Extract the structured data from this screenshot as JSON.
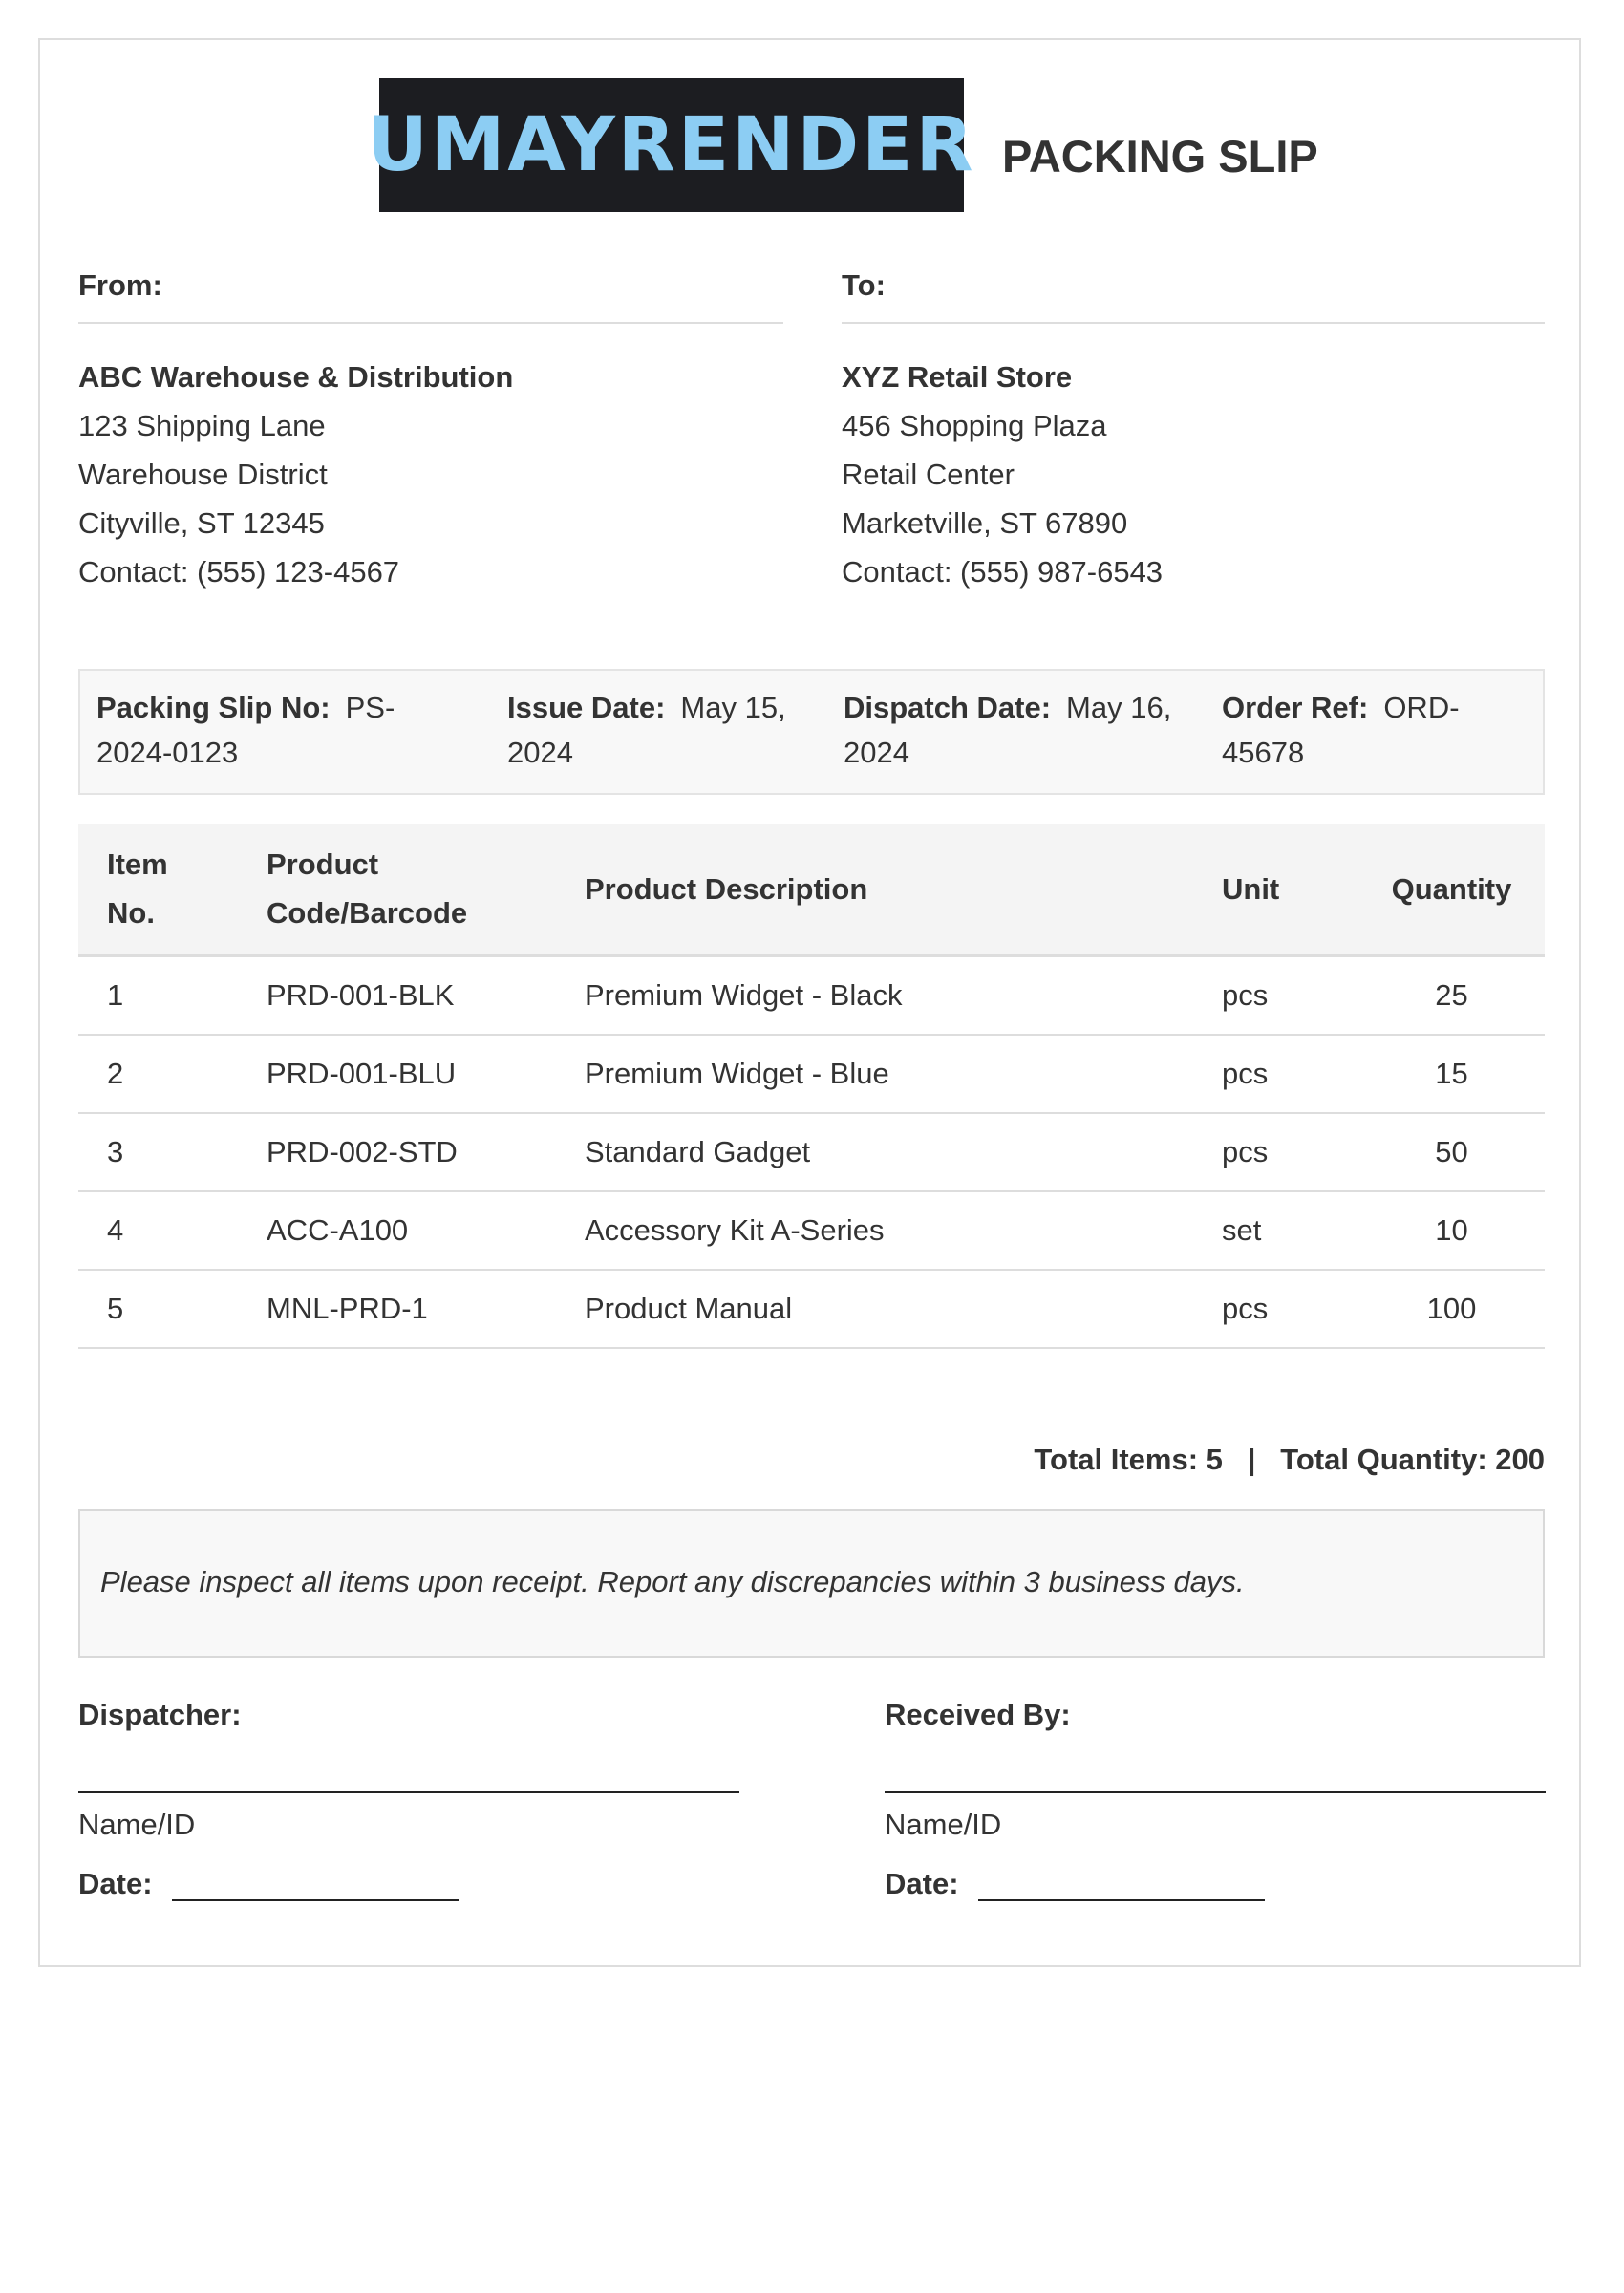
{
  "header": {
    "logo_text": "UMAYRENDER",
    "title": "PACKING SLIP"
  },
  "from": {
    "label": "From:",
    "name": "ABC Warehouse & Distribution",
    "lines": [
      "123 Shipping Lane",
      "Warehouse District",
      "Cityville, ST 12345",
      "Contact: (555) 123-4567"
    ]
  },
  "to": {
    "label": "To:",
    "name": "XYZ Retail Store",
    "lines": [
      "456 Shopping Plaza",
      "Retail Center",
      "Marketville, ST 67890",
      "Contact: (555) 987-6543"
    ]
  },
  "info": {
    "slip_no_label": "Packing Slip No:",
    "slip_no_l1": "PS-",
    "slip_no_l2": "2024-0123",
    "issue_label": "Issue Date:",
    "issue_l1": "May 15,",
    "issue_l2": "2024",
    "dispatch_label": "Dispatch Date:",
    "dispatch_l1": "May 16,",
    "dispatch_l2": "2024",
    "order_label": "Order Ref:",
    "order_l1": "ORD-",
    "order_l2": "45678"
  },
  "table": {
    "headers": {
      "item_l1": "Item",
      "item_l2": "No.",
      "code_l1": "Product",
      "code_l2": "Code/Barcode",
      "desc": "Product Description",
      "unit": "Unit",
      "qty": "Quantity"
    },
    "rows": [
      {
        "no": "1",
        "code": "PRD-001-BLK",
        "desc": "Premium Widget - Black",
        "unit": "pcs",
        "qty": "25"
      },
      {
        "no": "2",
        "code": "PRD-001-BLU",
        "desc": "Premium Widget - Blue",
        "unit": "pcs",
        "qty": "15"
      },
      {
        "no": "3",
        "code": "PRD-002-STD",
        "desc": "Standard Gadget",
        "unit": "pcs",
        "qty": "50"
      },
      {
        "no": "4",
        "code": "ACC-A100",
        "desc": "Accessory Kit A-Series",
        "unit": "set",
        "qty": "10"
      },
      {
        "no": "5",
        "code": "MNL-PRD-1",
        "desc": "Product Manual",
        "unit": "pcs",
        "qty": "100"
      }
    ]
  },
  "totals": "Total Items: 5   |   Total Quantity: 200",
  "note": "Please inspect all items upon receipt. Report any discrepancies within 3 business days.",
  "signatures": {
    "dispatcher_label": "Dispatcher:",
    "received_label": "Received By:",
    "name_id": "Name/ID",
    "date_label": "Date:"
  },
  "colors": {
    "logo_bg": "#1c1d21",
    "logo_text": "#8ccdf3",
    "text": "#333333",
    "panel_bg": "#f8f8f8",
    "rule": "#dddddd"
  }
}
